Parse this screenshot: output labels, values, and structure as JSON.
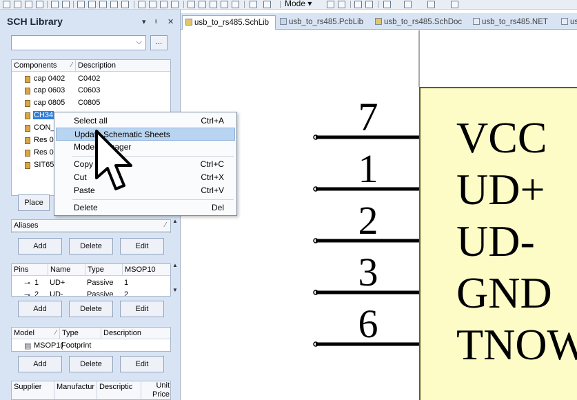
{
  "toolbar": {
    "mode_label": "Mode ▾"
  },
  "panel": {
    "title": "SCH Library",
    "controls": [
      "▾",
      "ᵻ",
      "✕"
    ],
    "filter_value": "",
    "filter_button": "...",
    "components": {
      "headers": [
        "Components",
        "Description"
      ],
      "rows": [
        {
          "name": "cap 0402",
          "desc": "C0402"
        },
        {
          "name": "cap 0603",
          "desc": "C0603"
        },
        {
          "name": "cap 0805",
          "desc": "C0805"
        },
        {
          "name": "CH34",
          "desc": ""
        },
        {
          "name": "CON_",
          "desc": ""
        },
        {
          "name": "Res 0",
          "desc": ""
        },
        {
          "name": "Res 0",
          "desc": ""
        },
        {
          "name": "SIT65",
          "desc": ""
        }
      ]
    },
    "place_button": "Place",
    "aliases": {
      "header": "Aliases",
      "add": "Add",
      "delete": "Delete",
      "edit": "Edit"
    },
    "pins": {
      "headers": [
        "Pins",
        "Name",
        "Type",
        "MSOP10"
      ],
      "rows": [
        {
          "pin": "1",
          "name": "UD+",
          "type": "Passive",
          "msop": "1"
        },
        {
          "pin": "2",
          "name": "UD-",
          "type": "Passive",
          "msop": "2"
        }
      ],
      "add": "Add",
      "delete": "Delete",
      "edit": "Edit"
    },
    "model": {
      "headers": [
        "Model",
        "Type",
        "Description"
      ],
      "rows": [
        {
          "model": "MSOP1(",
          "type": "Footprint",
          "desc": ""
        }
      ],
      "add": "Add",
      "delete": "Delete",
      "edit": "Edit"
    },
    "supplier": {
      "headers": [
        "Supplier",
        "Manufactur",
        "Descriptic",
        "Unit Price"
      ]
    }
  },
  "tabs": [
    {
      "label": "usb_to_rs485.SchLib",
      "active": true
    },
    {
      "label": "usb_to_rs485.PcbLib",
      "active": false
    },
    {
      "label": "usb_to_rs485.SchDoc",
      "active": false
    },
    {
      "label": "usb_to_rs485.NET",
      "active": false
    },
    {
      "label": "usl",
      "active": false
    }
  ],
  "context_menu": {
    "items": [
      {
        "label": "Select all",
        "shortcut": "Ctrl+A"
      },
      {
        "label": "Update Schematic Sheets",
        "shortcut": "",
        "highlighted": true
      },
      {
        "label": "Model Manager",
        "shortcut": ""
      },
      {
        "label": "Copy",
        "shortcut": "Ctrl+C"
      },
      {
        "label": "Cut",
        "shortcut": "Ctrl+X"
      },
      {
        "label": "Paste",
        "shortcut": "Ctrl+V"
      },
      {
        "label": "Delete",
        "shortcut": "Del"
      }
    ]
  },
  "schematic": {
    "pins": [
      {
        "number": "7",
        "name": "VCC"
      },
      {
        "number": "1",
        "name": "UD+"
      },
      {
        "number": "2",
        "name": "UD-"
      },
      {
        "number": "3",
        "name": "GND"
      },
      {
        "number": "6",
        "name": "TNOW"
      }
    ]
  },
  "colors": {
    "panel_bg": "#d8e4f4",
    "selection": "#2f7ed8",
    "menu_highlight": "#b9d4f0",
    "component_fill": "#fdfcc7"
  }
}
